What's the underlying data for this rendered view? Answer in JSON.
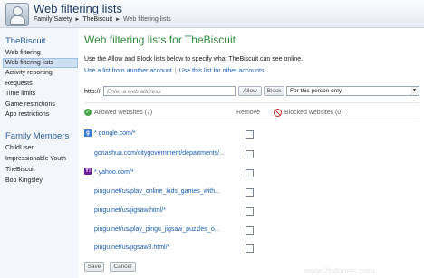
{
  "header": {
    "title": "Web filtering lists",
    "breadcrumb": [
      "Family Safety",
      "TheBiscuit",
      "Web filtering lists"
    ],
    "sep": "►"
  },
  "sidebar": {
    "user": "TheBiscuit",
    "items": [
      "Web filtering",
      "Web filtering lists",
      "Activity reporting",
      "Requests",
      "Time limits",
      "Game restrictions",
      "App restrictions"
    ],
    "active_index": 1,
    "family_heading": "Family Members",
    "members": [
      "ChildUser",
      "Impressionable Youth",
      "TheBiscuit",
      "Bob Kingsley"
    ]
  },
  "main": {
    "title": "Web filtering lists for TheBiscuit",
    "description": "Use the Allow and Block lists below to specify what TheBiscuit can see online.",
    "link_use_list": "Use a list from another account",
    "link_sep": "|",
    "link_share_list": "Use this list for other accounts",
    "url_label": "http://",
    "url_placeholder": "Enter a web address",
    "allow_button": "Allow",
    "block_button": "Block",
    "scope_select": "For this person only",
    "allowed_header": "Allowed websites (7)",
    "remove_header": "Remove",
    "blocked_header": "Blocked websites (0)",
    "allowed_sites": [
      {
        "url": "*.google.com/*",
        "icon": "google-icon"
      },
      {
        "url": "gonashua.com/citygovernment/departments/...",
        "icon": ""
      },
      {
        "url": "*.yahoo.com/*",
        "icon": "yahoo-icon"
      },
      {
        "url": "pingu.net/us/play_online_kids_games_with...",
        "icon": ""
      },
      {
        "url": "pingu.net/us/jigsaw.html/*",
        "icon": ""
      },
      {
        "url": "pingu.net/us/play_pingu_jigsaw_puzzles_o...",
        "icon": ""
      },
      {
        "url": "pingu.net/us/jigsaw3.html/*",
        "icon": ""
      }
    ],
    "save_button": "Save",
    "cancel_button": "Cancel"
  },
  "watermark": "www.7tutorials.com",
  "colors": {
    "accent_green": "#2f8a3c",
    "link_blue": "#1a5fb4",
    "sidebar_blue": "#2a5e9a"
  }
}
